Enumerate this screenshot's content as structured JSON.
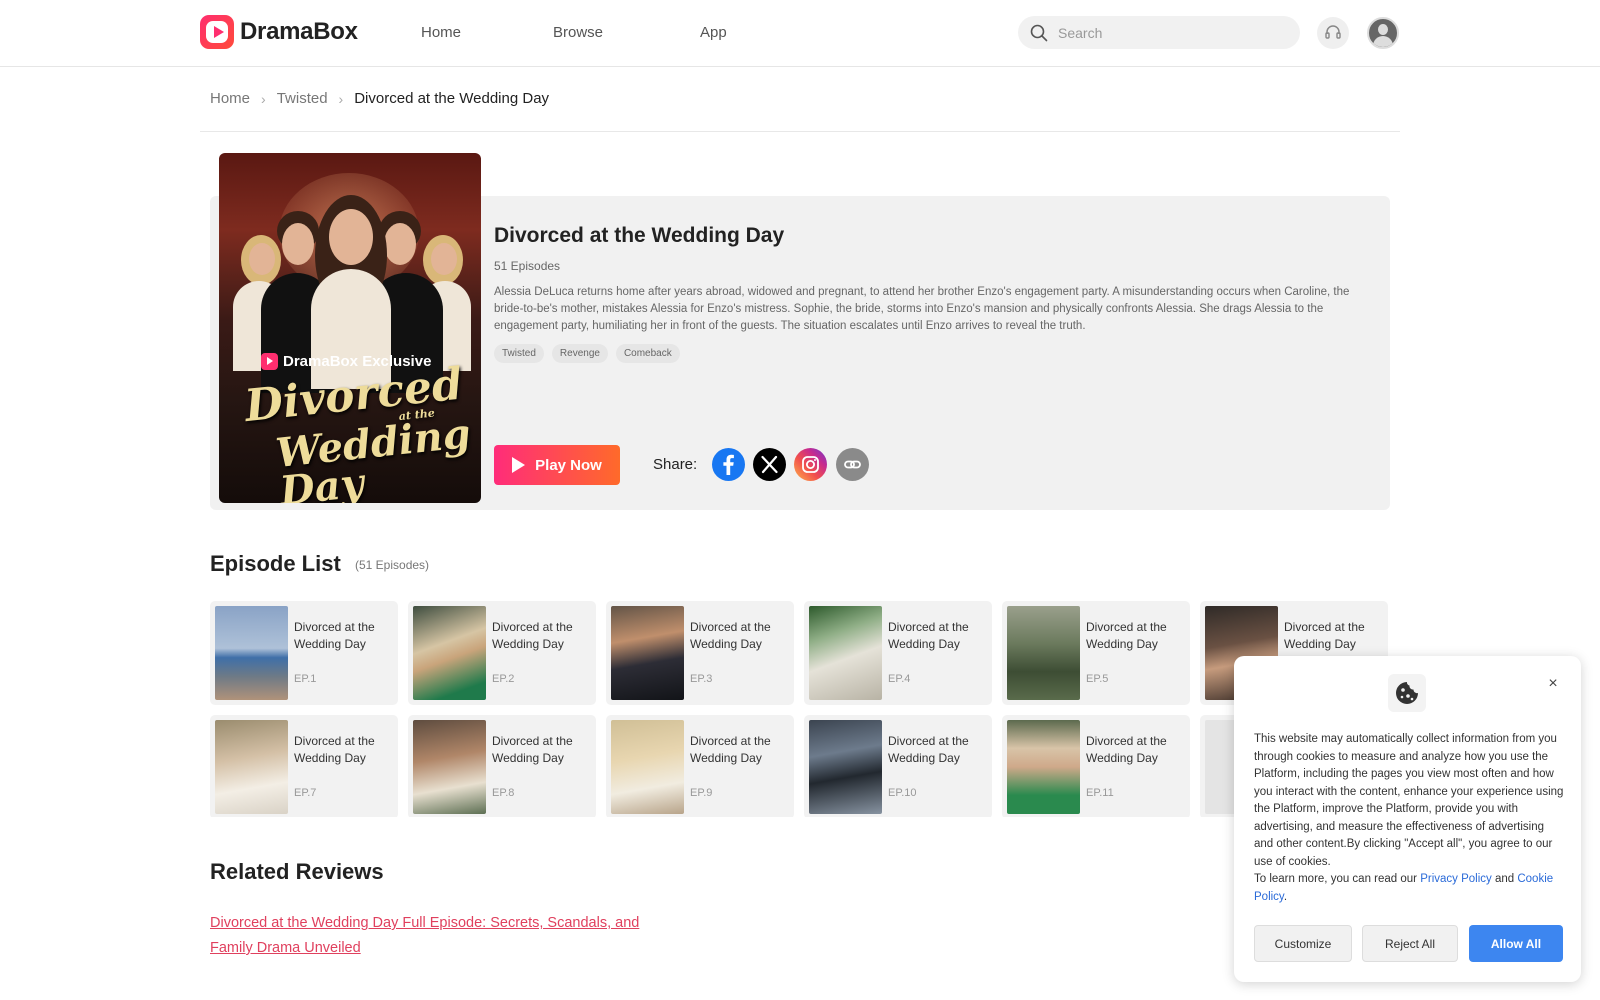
{
  "header": {
    "logo_text": "DramaBox",
    "nav": [
      "Home",
      "Browse",
      "App"
    ],
    "search_placeholder": "Search",
    "brand_color": "#ff2e6f"
  },
  "breadcrumb": {
    "items": [
      "Home",
      "Twisted"
    ],
    "current": "Divorced at the Wedding Day"
  },
  "drama": {
    "poster": {
      "brand": "DramaBox Exclusive",
      "title_line1": "Divorced",
      "title_line2": "at the",
      "title_line3": "Wedding Day"
    },
    "title": "Divorced at the Wedding Day",
    "episodes_label": "51 Episodes",
    "description": "Alessia DeLuca returns home after years abroad, widowed and pregnant, to attend her brother Enzo's engagement party. A misunderstanding occurs when Caroline, the bride-to-be's mother, mistakes Alessia for Enzo's mistress. Sophie, the bride, storms into Enzo's mansion and physically confronts Alessia. She drags Alessia to the engagement party, humiliating her in front of the guests. The situation escalates until Enzo arrives to reveal the truth.",
    "tags": [
      "Twisted",
      "Revenge",
      "Comeback"
    ],
    "play_label": "Play Now",
    "share_label": "Share:",
    "share_icons": [
      "facebook-icon",
      "x-icon",
      "instagram-icon",
      "link-icon"
    ]
  },
  "episode_list": {
    "heading": "Episode List",
    "count_label": "(51 Episodes)",
    "episodes": [
      {
        "title": "Divorced at the Wedding Day",
        "ep": "EP.1"
      },
      {
        "title": "Divorced at the Wedding Day",
        "ep": "EP.2"
      },
      {
        "title": "Divorced at the Wedding Day",
        "ep": "EP.3"
      },
      {
        "title": "Divorced at the Wedding Day",
        "ep": "EP.4"
      },
      {
        "title": "Divorced at the Wedding Day",
        "ep": "EP.5"
      },
      {
        "title": "Divorced at the Wedding Day",
        "ep": ""
      },
      {
        "title": "Divorced at the Wedding Day",
        "ep": "EP.7"
      },
      {
        "title": "Divorced at the Wedding Day",
        "ep": "EP.8"
      },
      {
        "title": "Divorced at the Wedding Day",
        "ep": "EP.9"
      },
      {
        "title": "Divorced at the Wedding Day",
        "ep": "EP.10"
      },
      {
        "title": "Divorced at the Wedding Day",
        "ep": "EP.11"
      },
      {
        "title": "",
        "ep": ""
      }
    ]
  },
  "reviews": {
    "heading": "Related Reviews",
    "link_text": "Divorced at the Wedding Day Full Episode: Secrets, Scandals, and Family Drama Unveiled"
  },
  "cookie_banner": {
    "text": "This website may automatically collect information from you through cookies to measure and analyze how you use the Platform, including the pages you view most often and how you interact with the content, enhance your experience using the Platform, improve the Platform, provide you with advertising, and measure the effectiveness of advertising and other content.By clicking \"Accept all\", you agree to our use of cookies.",
    "learn_prefix": "To learn more, you can read our ",
    "privacy_link": "Privacy Policy",
    "and": " and ",
    "cookie_link": "Cookie Policy",
    "period": ".",
    "customize_label": "Customize",
    "reject_label": "Reject All",
    "allow_label": "Allow All",
    "close_symbol": "×",
    "accent_color": "#3d86f0"
  }
}
